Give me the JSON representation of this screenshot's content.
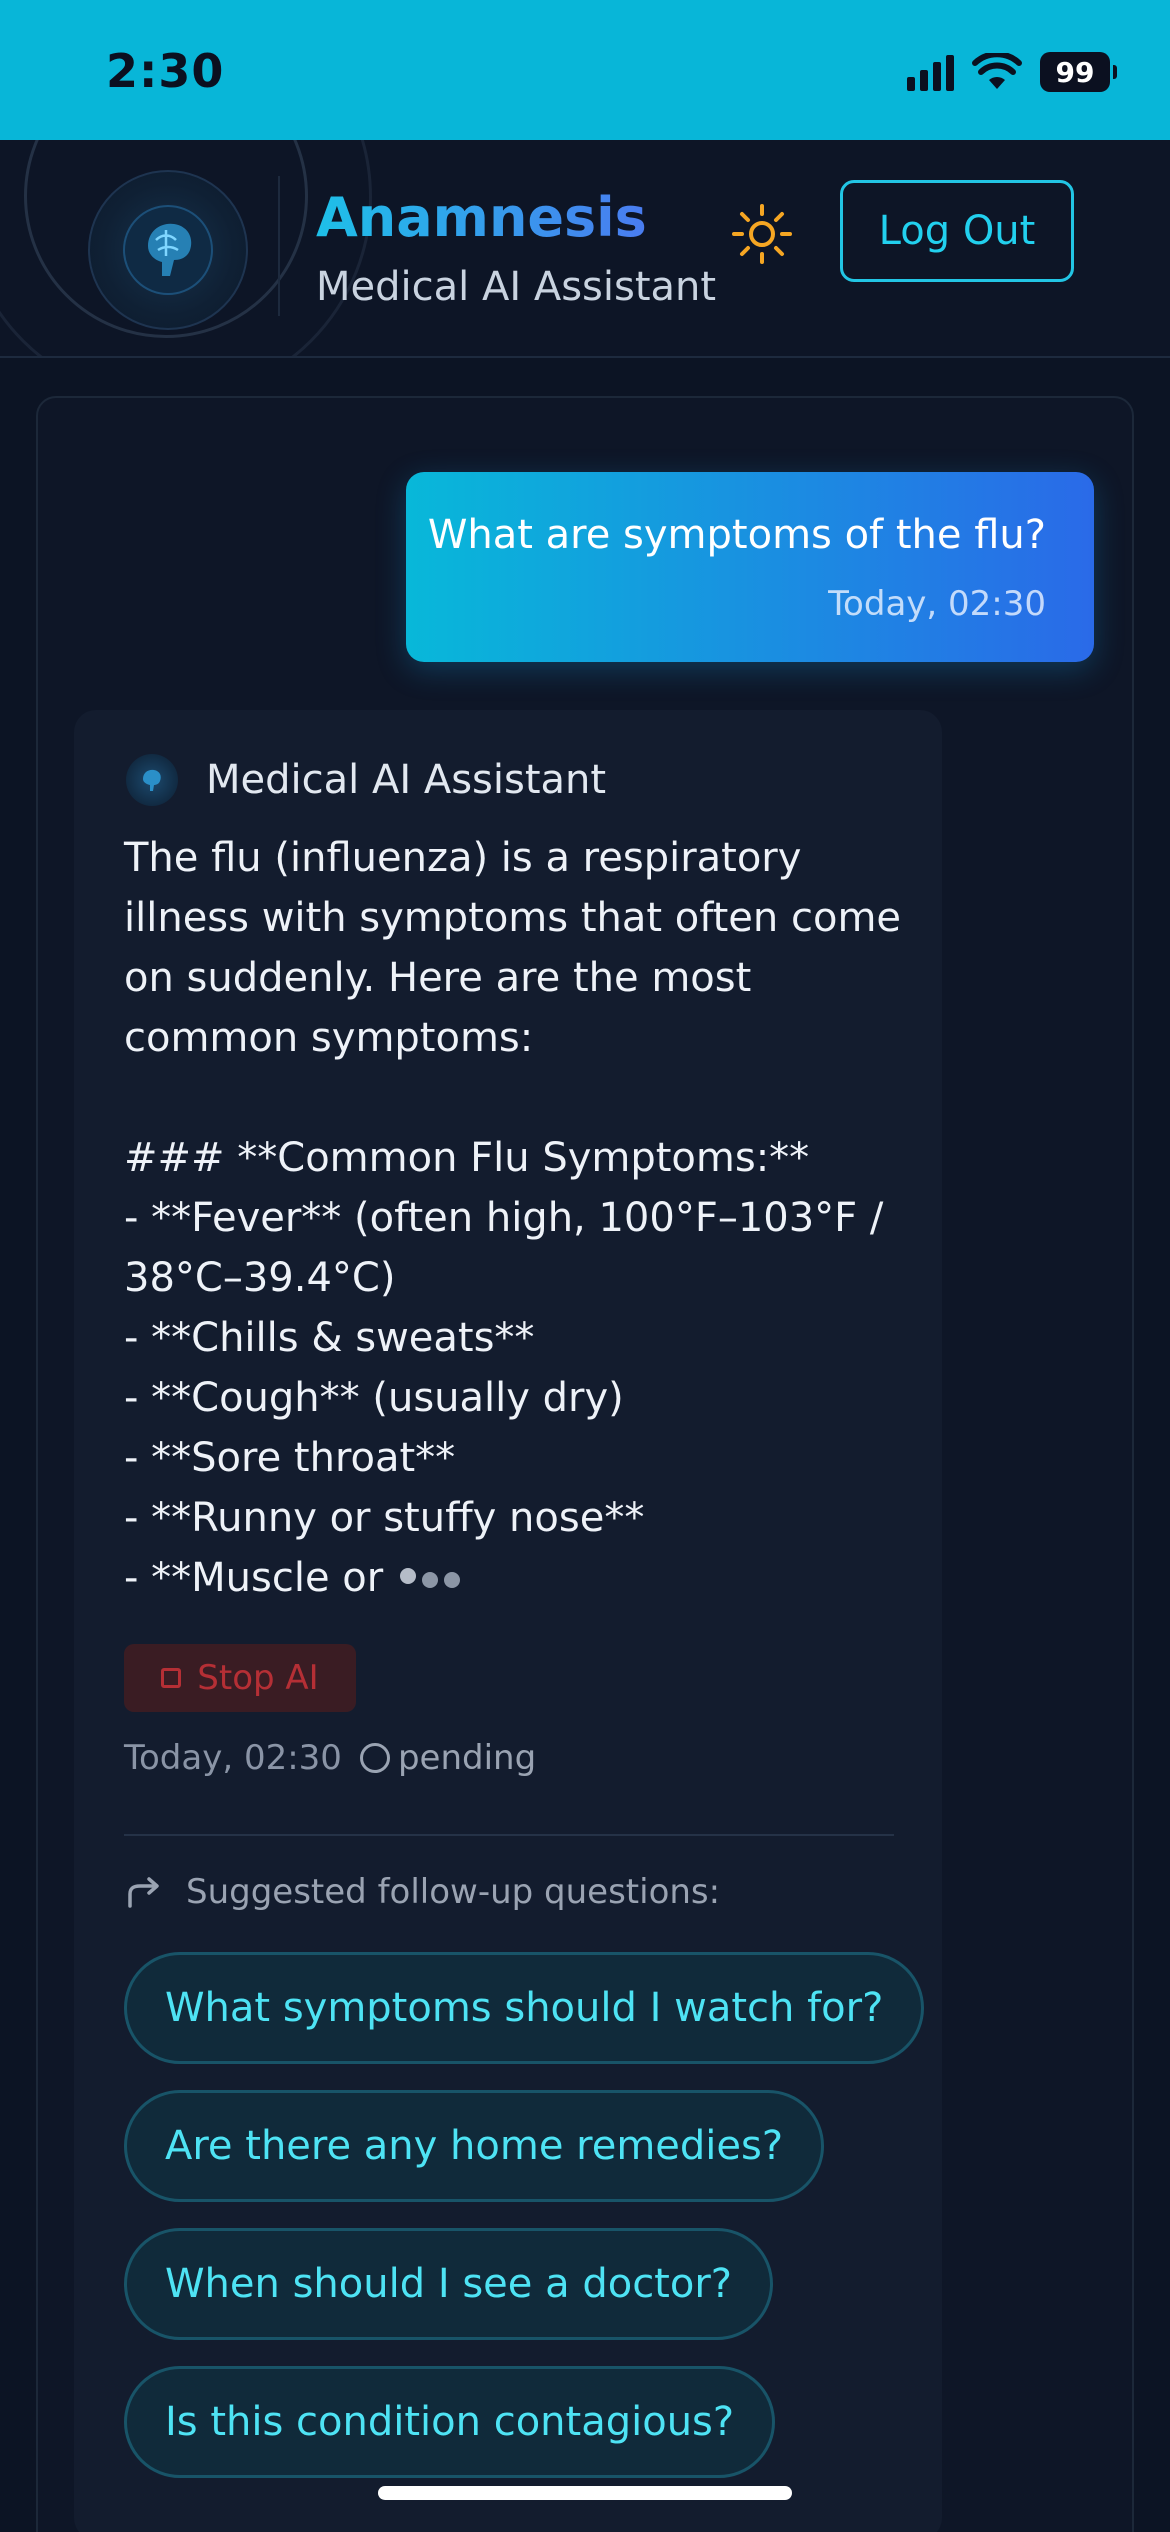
{
  "status_bar": {
    "time": "2:30",
    "battery": "99",
    "icons": [
      "cellular-signal-icon",
      "wifi-icon",
      "battery-icon"
    ]
  },
  "header": {
    "title": "Anamnesis",
    "subtitle": "Medical AI Assistant",
    "theme_icon": "sun-icon",
    "logout_label": "Log Out",
    "accent": "#22c5e4"
  },
  "conversation": {
    "user_message": {
      "text": "What are symptoms of the flu?",
      "time": "Today, 02:30"
    },
    "assistant": {
      "name": "Medical AI Assistant",
      "message": "The flu (influenza) is a respiratory illness with symptoms that often come on suddenly. Here are the most common symptoms:\n\n### **Common Flu Symptoms:**\n- **Fever** (often high, 100°F–103°F / 38°C–39.4°C)\n- **Chills & sweats**\n- **Cough** (usually dry)\n- **Sore throat**\n- **Runny or stuffy nose**\n- **Muscle or",
      "stop_label": "Stop AI",
      "time": "Today, 02:30",
      "status": "pending"
    },
    "suggestions": {
      "heading": "Suggested follow-up questions:",
      "items": [
        "What symptoms should I watch for?",
        "Are there any home remedies?",
        "When should I see a doctor?",
        "Is this condition contagious?"
      ]
    }
  }
}
